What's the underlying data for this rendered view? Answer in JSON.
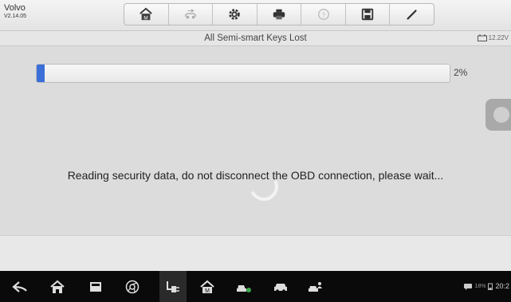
{
  "app": {
    "make": "Volvo",
    "version": "V2.14.05"
  },
  "toolbar": {
    "buttons": [
      {
        "name": "home",
        "icon": "home-icon",
        "active": true
      },
      {
        "name": "vehicle-swap",
        "icon": "vehicle-swap-icon",
        "active": false
      },
      {
        "name": "settings",
        "icon": "gear-icon",
        "active": true
      },
      {
        "name": "print",
        "icon": "printer-icon",
        "active": true
      },
      {
        "name": "help",
        "icon": "help-icon",
        "active": false
      },
      {
        "name": "save",
        "icon": "save-icon",
        "active": true
      },
      {
        "name": "edit",
        "icon": "pen-icon",
        "active": true
      }
    ]
  },
  "title": "All Semi-smart Keys Lost",
  "battery_voltage": "12.22V",
  "progress": {
    "percent": 2,
    "label": "2%"
  },
  "message": "Reading security data, do not disconnect the OBD connection, please wait...",
  "status": {
    "battery_percent": "18%",
    "time": "20:2"
  },
  "colors": {
    "progress_fill": "#3a6fd8",
    "navbar_bg": "#0a0a0a"
  }
}
